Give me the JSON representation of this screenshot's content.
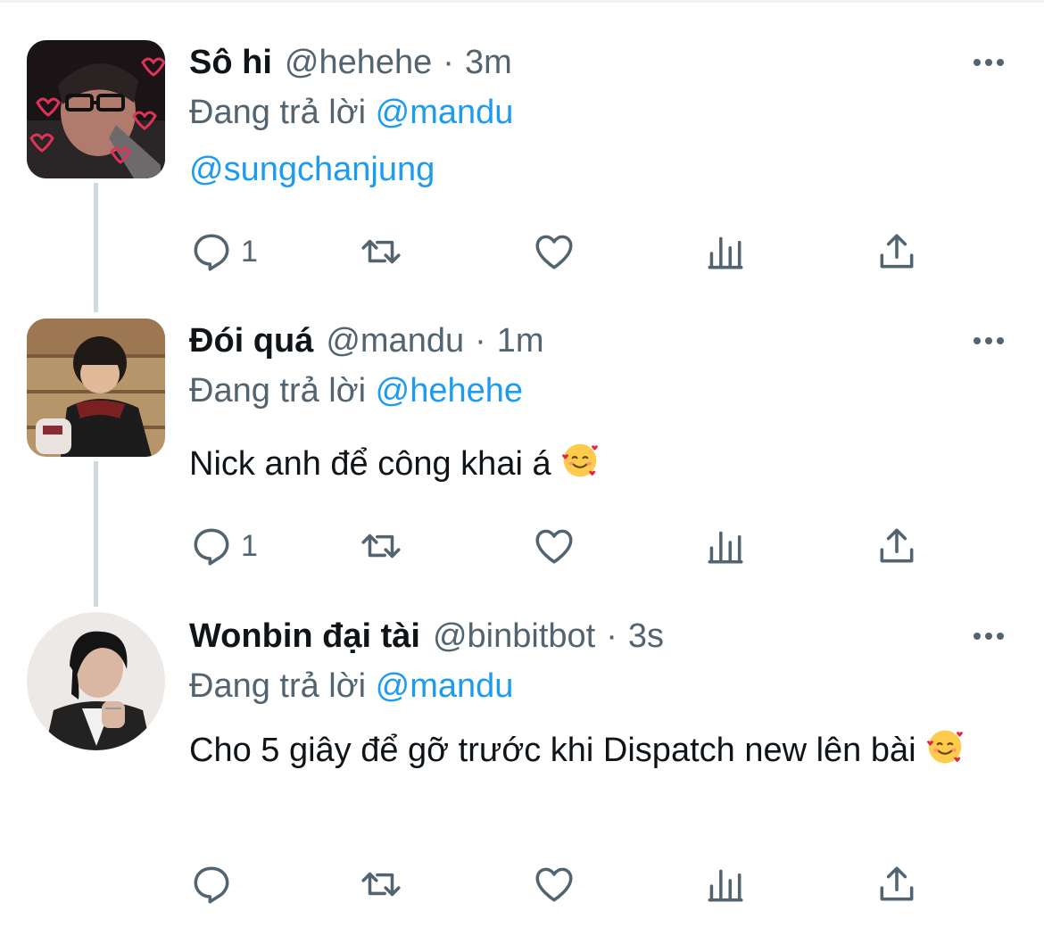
{
  "tweets": [
    {
      "name": "Sô hi",
      "handle": "@hehehe",
      "separator": "·",
      "time": "3m",
      "reply_prefix": "Đang trả lời",
      "reply_to": "@mandu",
      "text": "@sungchanjung",
      "reply_count": "1"
    },
    {
      "name": "Đói quá",
      "handle": "@mandu",
      "separator": "·",
      "time": "1m",
      "reply_prefix": "Đang trả lời",
      "reply_to": "@hehehe",
      "text": "Nick anh để công khai á",
      "emoji": "smiling-face-with-hearts",
      "reply_count": "1"
    },
    {
      "name": "Wonbin đại tài",
      "handle": "@binbitbot",
      "separator": "·",
      "time": "3s",
      "reply_prefix": "Đang trả lời",
      "reply_to": "@mandu",
      "text": "Cho 5 giây để gỡ trước khi Dispatch new lên bài",
      "emoji": "smiling-face-with-hearts",
      "reply_count": ""
    }
  ],
  "colors": {
    "accent": "#1d9bf0",
    "secondary_text": "#536471",
    "thread_line": "#cfd9de"
  }
}
